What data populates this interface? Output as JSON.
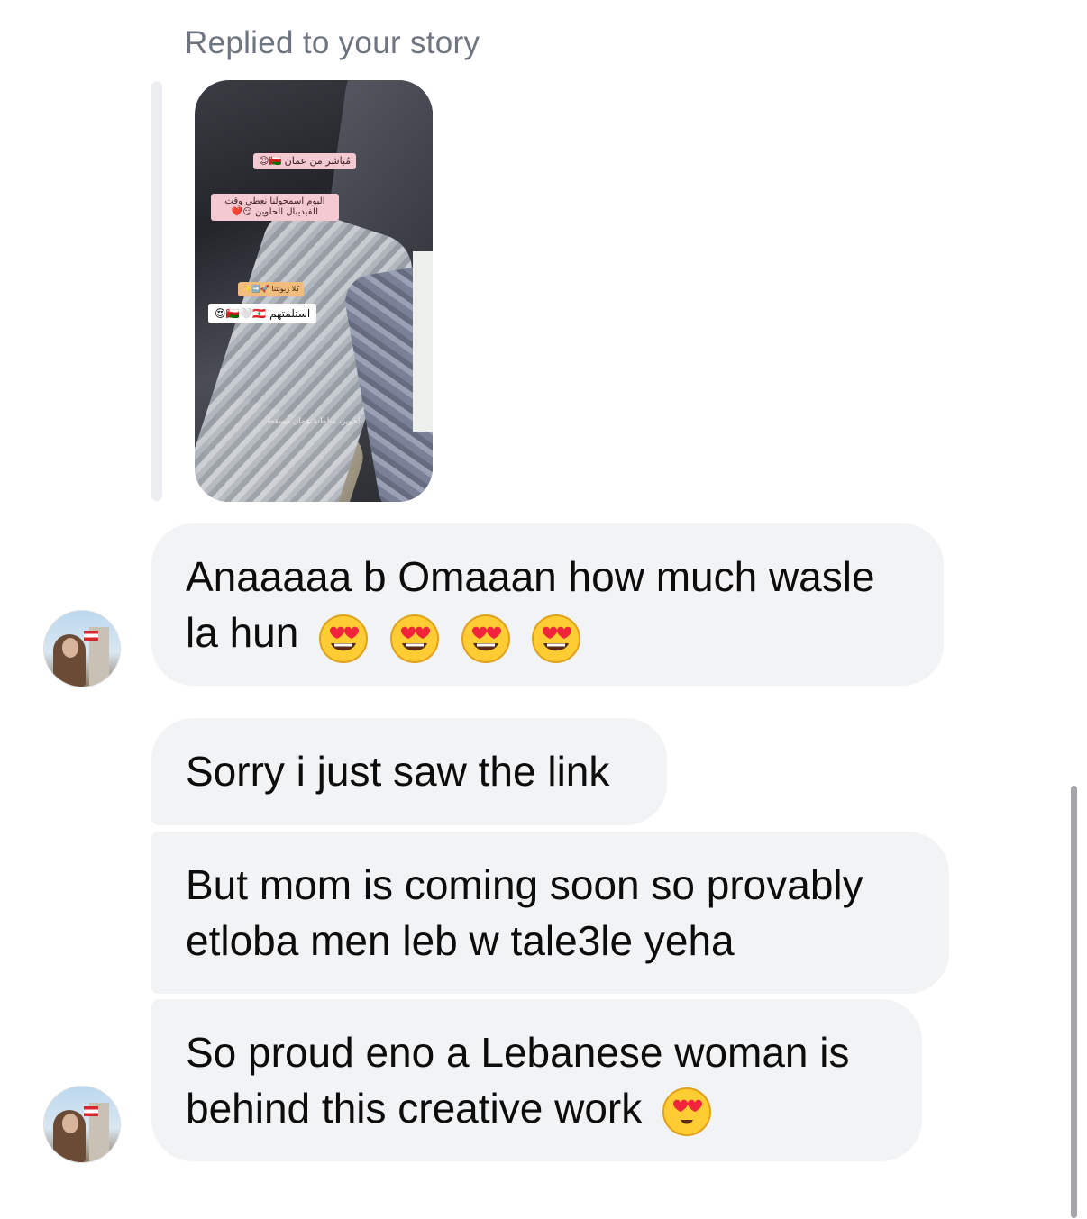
{
  "header": {
    "reply_label": "Replied to your story"
  },
  "story": {
    "stickers": [
      "مُباشر من عمان 🇴🇲😍",
      "اليوم اسمحولنا نعطي وقت للفيديبال الحلوين 😏❤️",
      "كلا زبونتنا 🚀➡️✨",
      "استلمتهم 🇴🇲🤍🇱🇧😍",
      "الخوير، سلطنة عمان مسقط"
    ]
  },
  "messages": [
    {
      "text_line1": "Anaaaaa b Omaaan how much wasle",
      "text_line2": "la hun",
      "emoji": "smiling-face-with-heart-eyes",
      "emoji_count": 4
    },
    {
      "text": "Sorry i just saw the link"
    },
    {
      "text_line1": "But mom is coming soon so provably",
      "text_line2": "etloba men leb w tale3le yeha"
    },
    {
      "text_line1": "So proud eno a Lebanese woman is",
      "text_line2": "behind this creative work",
      "emoji": "smiling-face-with-heart-eyes",
      "emoji_count": 1
    }
  ],
  "colors": {
    "bubble": "#f2f3f5",
    "label": "#6e7480",
    "text": "#0c0c0c"
  }
}
